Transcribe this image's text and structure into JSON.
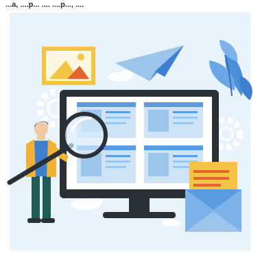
{
  "title": "...a, ....p... .... ....p..., ....",
  "colors": {
    "background": "#e9f3fb",
    "monitor_frame": "#2b2f36",
    "screen": "#ffffff",
    "card_header": "#5b9be0",
    "card_body": "#cfe3f6",
    "accent_yellow": "#f6c445",
    "accent_orange": "#e4632f",
    "plant": "#4a8fd8",
    "gear": "#dce8f3",
    "person_shirt": "#f2b233",
    "person_pants": "#1f5c56",
    "magnifier_rim": "#2b2f36"
  },
  "illustration": {
    "subject": "person inspecting website layout on monitor with magnifying glass",
    "icons": [
      "image-icon",
      "paper-plane-icon",
      "gear-icon",
      "envelope-icon",
      "plant-icon",
      "cloud-icon",
      "magnifying-glass-icon"
    ],
    "screen_cards": 4
  }
}
